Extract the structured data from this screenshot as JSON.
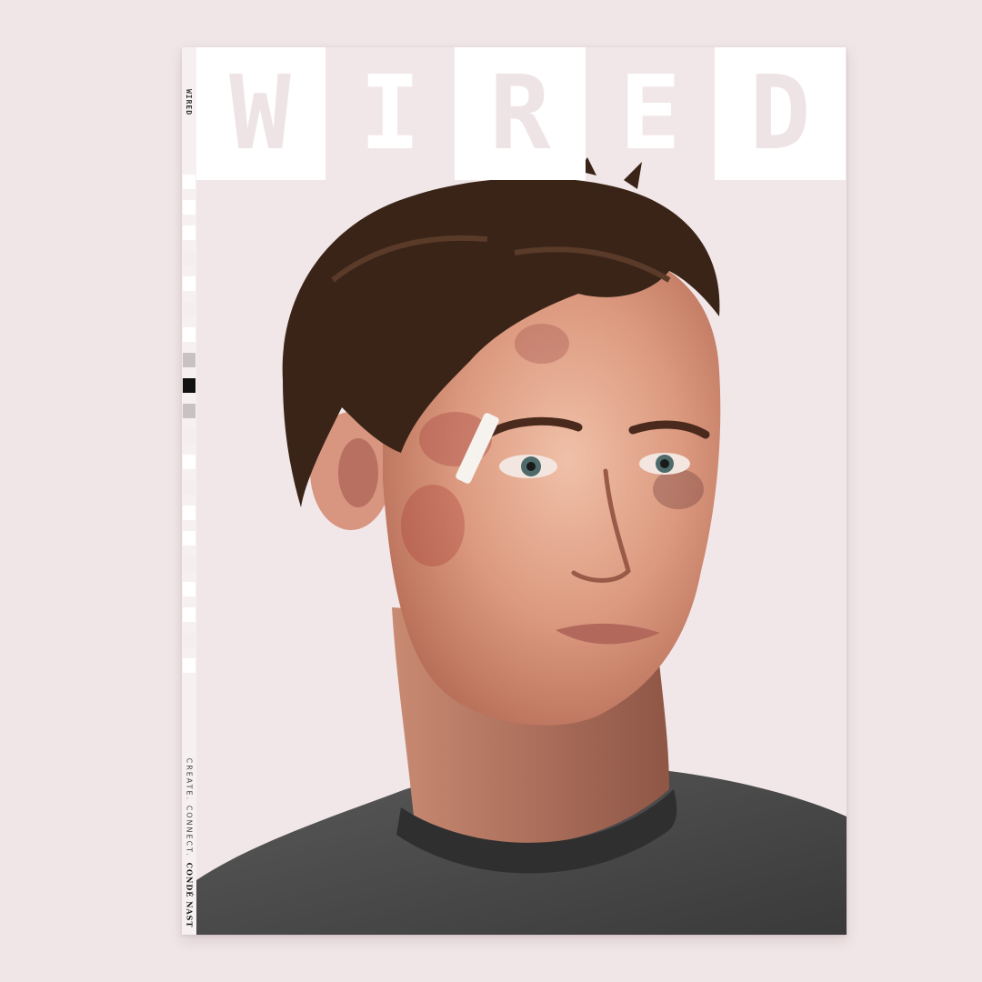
{
  "magazine": {
    "masthead_letters": [
      "W",
      "I",
      "R",
      "E",
      "D"
    ],
    "spine_logo": "WIRED",
    "spine_tagline": "CREATE. CONNECT.",
    "spine_brand": "CONDÉ NAST"
  },
  "cover": {
    "image_description_icon": "portrait-photo-icon"
  },
  "colors": {
    "page_background": "#f0e6e7",
    "cover_background": "#f2e7e8",
    "masthead_box": "#ffffff",
    "shirt": "#4a4a4a",
    "hair": "#3a2418",
    "skin": "#e2a48c"
  }
}
